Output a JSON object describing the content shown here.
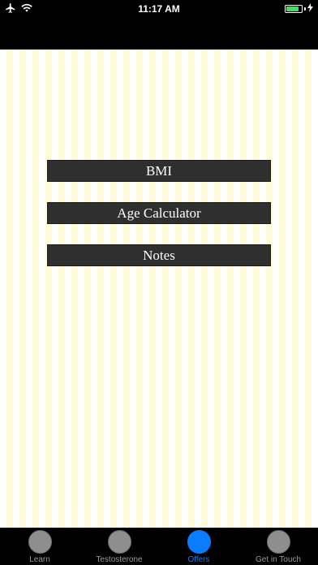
{
  "status_bar": {
    "time": "11:17 AM",
    "battery_level": 0.85,
    "battery_color": "#4cd964",
    "icons": [
      "airplane-icon",
      "wifi-icon",
      "battery-icon",
      "charging-bolt-icon"
    ]
  },
  "menu": {
    "buttons": [
      {
        "label": "BMI"
      },
      {
        "label": "Age Calculator"
      },
      {
        "label": "Notes"
      }
    ]
  },
  "tab_bar": {
    "accent_color": "#0a7cff",
    "active_index": 2,
    "tabs": [
      {
        "label": "Learn"
      },
      {
        "label": "Testosterone"
      },
      {
        "label": "Offers"
      },
      {
        "label": "Get in Touch"
      }
    ]
  }
}
